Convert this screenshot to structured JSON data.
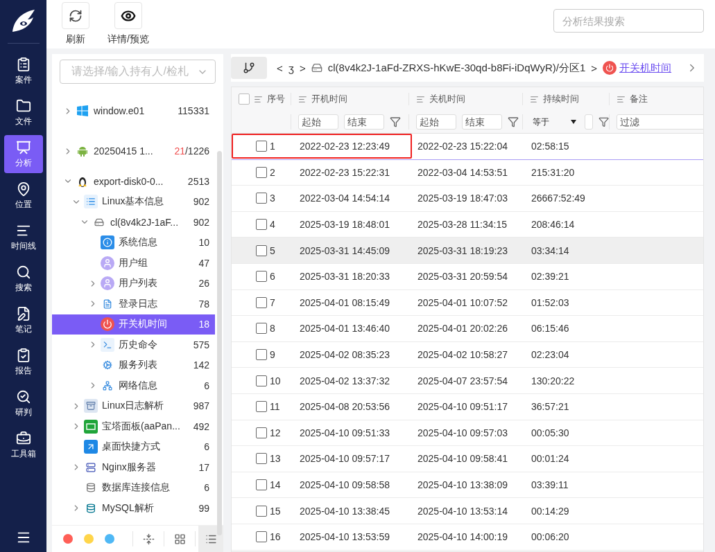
{
  "nav": [
    {
      "label": "案件",
      "selected": false
    },
    {
      "label": "文件",
      "selected": false
    },
    {
      "label": "分析",
      "selected": true
    },
    {
      "label": "位置",
      "selected": false
    },
    {
      "label": "时间线",
      "selected": false
    },
    {
      "label": "搜索",
      "selected": false
    },
    {
      "label": "笔记",
      "selected": false
    },
    {
      "label": "报告",
      "selected": false
    },
    {
      "label": "研判",
      "selected": false
    },
    {
      "label": "工具箱",
      "selected": false
    }
  ],
  "toolbar": {
    "buttons": [
      {
        "kind": "refresh",
        "label": "刷新"
      },
      {
        "kind": "preview",
        "label": "详情/预览"
      }
    ],
    "search": {
      "placeholder": "分析结果搜索"
    }
  },
  "tree_panel": {
    "owner_select": {
      "placeholder": "请选择/输入持有人/检札"
    },
    "tree": [
      {
        "kind": "windows",
        "label": "window.e01",
        "count": "115331",
        "expanded": false,
        "selected": false
      },
      {
        "kind": "android",
        "label": "20250415 1...",
        "hits": "21",
        "count": "/1226",
        "expanded": false,
        "selected": false
      },
      {
        "kind": "linux",
        "label": "export-disk0-0...",
        "count": "2513",
        "expanded": true,
        "selected": false,
        "children": [
          {
            "kind": "list",
            "label": "Linux基本信息",
            "count": "902",
            "expanded": true,
            "selected": false,
            "children": [
              {
                "kind": "disk",
                "label": "cl(8v4k2J-1aF...",
                "count": "902",
                "expanded": true,
                "selected": false,
                "children": [
                  {
                    "kind": "info",
                    "label": "系统信息",
                    "count": "10",
                    "selected": false
                  },
                  {
                    "kind": "user",
                    "label": "用户组",
                    "count": "47",
                    "selected": false
                  },
                  {
                    "kind": "user",
                    "label": "用户列表",
                    "count": "26",
                    "expanded": false,
                    "selected": false
                  },
                  {
                    "kind": "log",
                    "label": "登录日志",
                    "count": "78",
                    "expanded": false,
                    "selected": false
                  },
                  {
                    "kind": "power",
                    "label": "开关机时间",
                    "count": "18",
                    "selected": true
                  },
                  {
                    "kind": "terminal",
                    "label": "历史命令",
                    "count": "575",
                    "expanded": false,
                    "selected": false
                  },
                  {
                    "kind": "service",
                    "label": "服务列表",
                    "count": "142",
                    "selected": false
                  },
                  {
                    "kind": "network",
                    "label": "网络信息",
                    "count": "6",
                    "expanded": false,
                    "selected": false
                  }
                ]
              }
            ]
          },
          {
            "kind": "archive",
            "label": "Linux日志解析",
            "count": "987",
            "expanded": false,
            "selected": false
          },
          {
            "kind": "bt",
            "label": "宝塔面板(aaPan...",
            "count": "492",
            "expanded": false,
            "selected": false
          },
          {
            "kind": "shortcut",
            "label": "桌面快捷方式",
            "count": "6",
            "selected": false
          },
          {
            "kind": "server",
            "label": "Nginx服务器",
            "count": "17",
            "expanded": false,
            "selected": false
          },
          {
            "kind": "database",
            "label": "数据库连接信息",
            "count": "6",
            "selected": false
          },
          {
            "kind": "mysql",
            "label": "MySQL解析",
            "count": "99",
            "expanded": false,
            "selected": false
          }
        ]
      }
    ],
    "color_dots": [
      {
        "color": "#ff5f57"
      },
      {
        "color": "#ffd54a"
      },
      {
        "color": "#4fb8f5"
      }
    ],
    "view_buttons": [
      {
        "kind": "collapse",
        "selected": false
      },
      {
        "kind": "grid",
        "selected": false
      },
      {
        "kind": "list",
        "selected": true
      }
    ]
  },
  "breadcrumb": {
    "items": [
      {
        "kind": "back",
        "label": "<"
      },
      {
        "kind": "text",
        "label": "ʒ"
      },
      {
        "kind": "sep",
        "label": ">"
      },
      {
        "kind": "disk",
        "label": "cl(8v4k2J-1aFd-ZRXS-hKwE-30qd-b8Fi-iDqWyR)/分区1"
      },
      {
        "kind": "sep",
        "label": ">"
      },
      {
        "kind": "link",
        "label": "开关机时间"
      }
    ]
  },
  "table": {
    "columns": [
      "序号",
      "开机时间",
      "关机时间",
      "持续时间",
      "备注"
    ],
    "select_all_checked": false,
    "filters": [
      {
        "kind": "none"
      },
      {
        "kind": "range",
        "start": {
          "placeholder": "起始"
        },
        "end": {
          "placeholder": "结束"
        }
      },
      {
        "kind": "range",
        "start": {
          "placeholder": "起始"
        },
        "end": {
          "placeholder": "结束"
        }
      },
      {
        "kind": "select",
        "value": "等于"
      },
      {
        "kind": "text",
        "placeholder": "过滤"
      }
    ],
    "rows": [
      {
        "no": "1",
        "on": "2022-02-23 12:23:49",
        "off": "2022-02-23 15:22:04",
        "duration": "02:58:15",
        "selected": true,
        "hovered": false,
        "annotated": true,
        "checked": false
      },
      {
        "no": "2",
        "on": "2022-02-23 15:22:31",
        "off": "2022-03-04 14:53:51",
        "duration": "215:31:20",
        "selected": false,
        "hovered": false,
        "annotated": false,
        "checked": false
      },
      {
        "no": "3",
        "on": "2022-03-04 14:54:14",
        "off": "2025-03-19 18:47:03",
        "duration": "26667:52:49",
        "selected": false,
        "hovered": false,
        "annotated": false,
        "checked": false
      },
      {
        "no": "4",
        "on": "2025-03-19 18:48:01",
        "off": "2025-03-28 11:34:15",
        "duration": "208:46:14",
        "selected": false,
        "hovered": false,
        "annotated": false,
        "checked": false
      },
      {
        "no": "5",
        "on": "2025-03-31 14:45:09",
        "off": "2025-03-31 18:19:23",
        "duration": "03:34:14",
        "selected": false,
        "hovered": true,
        "annotated": false,
        "checked": false
      },
      {
        "no": "6",
        "on": "2025-03-31 18:20:33",
        "off": "2025-03-31 20:59:54",
        "duration": "02:39:21",
        "selected": false,
        "hovered": false,
        "annotated": false,
        "checked": false
      },
      {
        "no": "7",
        "on": "2025-04-01 08:15:49",
        "off": "2025-04-01 10:07:52",
        "duration": "01:52:03",
        "selected": false,
        "hovered": false,
        "annotated": false,
        "checked": false
      },
      {
        "no": "8",
        "on": "2025-04-01 13:46:40",
        "off": "2025-04-01 20:02:26",
        "duration": "06:15:46",
        "selected": false,
        "hovered": false,
        "annotated": false,
        "checked": false
      },
      {
        "no": "9",
        "on": "2025-04-02 08:35:23",
        "off": "2025-04-02 10:58:27",
        "duration": "02:23:04",
        "selected": false,
        "hovered": false,
        "annotated": false,
        "checked": false
      },
      {
        "no": "10",
        "on": "2025-04-02 13:37:32",
        "off": "2025-04-07 23:57:54",
        "duration": "130:20:22",
        "selected": false,
        "hovered": false,
        "annotated": false,
        "checked": false
      },
      {
        "no": "11",
        "on": "2025-04-08 20:53:56",
        "off": "2025-04-10 09:51:17",
        "duration": "36:57:21",
        "selected": false,
        "hovered": false,
        "annotated": false,
        "checked": false
      },
      {
        "no": "12",
        "on": "2025-04-10 09:51:33",
        "off": "2025-04-10 09:57:03",
        "duration": "00:05:30",
        "selected": false,
        "hovered": false,
        "annotated": false,
        "checked": false
      },
      {
        "no": "13",
        "on": "2025-04-10 09:57:17",
        "off": "2025-04-10 09:58:41",
        "duration": "00:01:24",
        "selected": false,
        "hovered": false,
        "annotated": false,
        "checked": false
      },
      {
        "no": "14",
        "on": "2025-04-10 09:58:58",
        "off": "2025-04-10 13:38:09",
        "duration": "03:39:11",
        "selected": false,
        "hovered": false,
        "annotated": false,
        "checked": false
      },
      {
        "no": "15",
        "on": "2025-04-10 13:38:45",
        "off": "2025-04-10 13:53:14",
        "duration": "00:14:29",
        "selected": false,
        "hovered": false,
        "annotated": false,
        "checked": false
      },
      {
        "no": "16",
        "on": "2025-04-10 13:53:59",
        "off": "2025-04-10 14:00:19",
        "duration": "00:06:20",
        "selected": false,
        "hovered": false,
        "annotated": false,
        "checked": false
      }
    ]
  }
}
